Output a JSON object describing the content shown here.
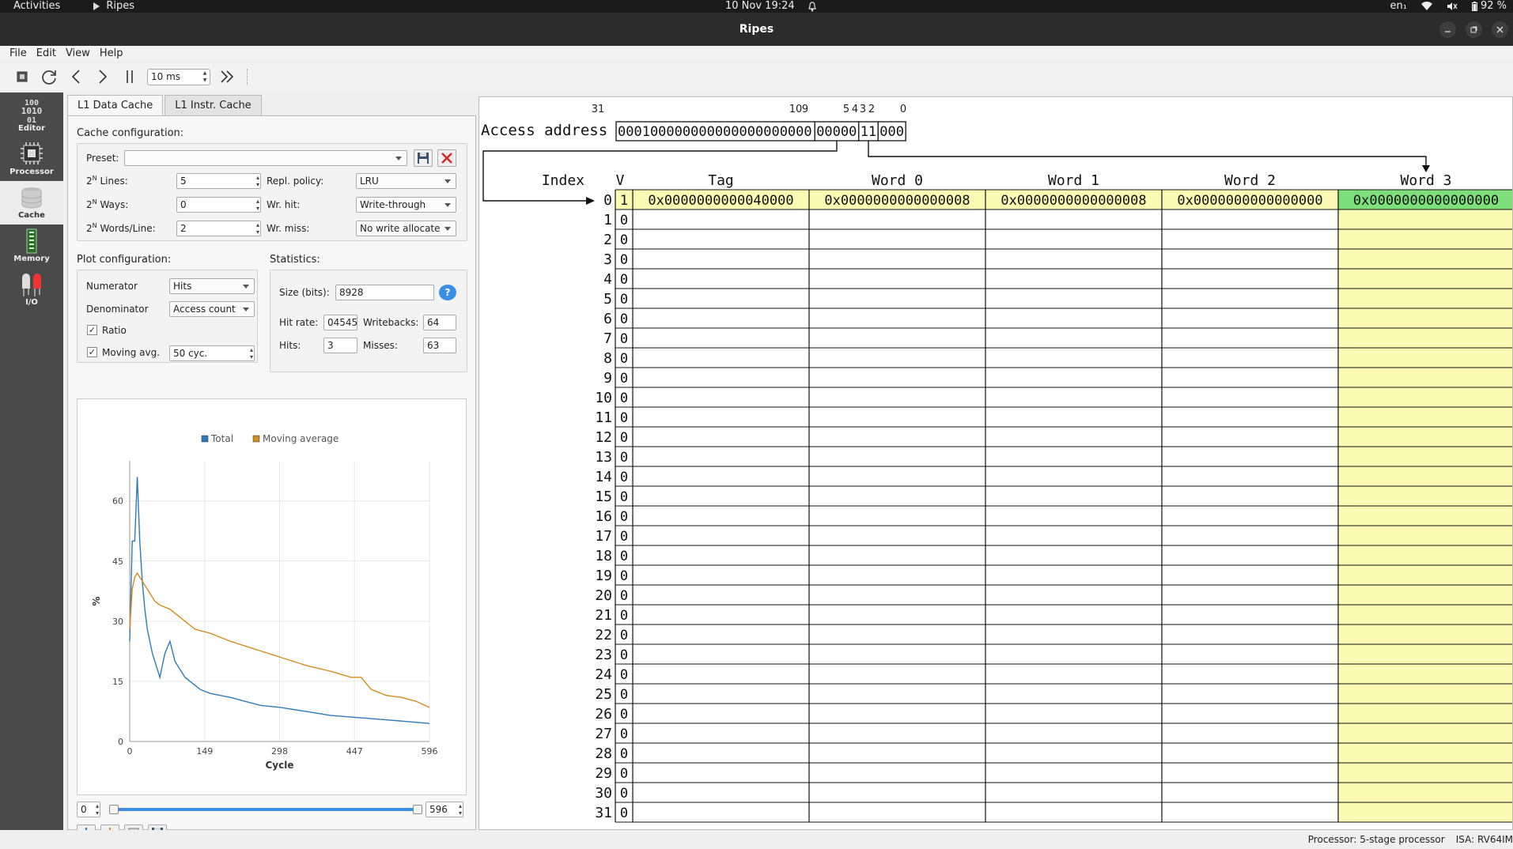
{
  "topbar": {
    "activities": "Activities",
    "app": "Ripes",
    "datetime": "10 Nov  19:24",
    "lang": "en₁",
    "battery": "92 %"
  },
  "window": {
    "title": "Ripes"
  },
  "menu": [
    "File",
    "Edit",
    "View",
    "Help"
  ],
  "toolbar": {
    "delay": "10 ms"
  },
  "sidebar": [
    {
      "label": "Editor",
      "icon": "binary-icon"
    },
    {
      "label": "Processor",
      "icon": "chip-icon"
    },
    {
      "label": "Cache",
      "icon": "database-icon"
    },
    {
      "label": "Memory",
      "icon": "memory-icon"
    },
    {
      "label": "I/O",
      "icon": "leds-icon"
    }
  ],
  "tabs": [
    "L1 Data Cache",
    "L1 Instr. Cache"
  ],
  "cache_config": {
    "title": "Cache configuration:",
    "preset_label": "Preset:",
    "preset_value": "",
    "lines_label": "Lines:",
    "lines_value": "5",
    "ways_label": "Ways:",
    "ways_value": "0",
    "words_label": "Words/Line:",
    "words_value": "2",
    "pow_base": "2",
    "pow_exp": "N",
    "repl_label": "Repl. policy:",
    "repl_value": "LRU",
    "wrhit_label": "Wr. hit:",
    "wrhit_value": "Write-through",
    "wrmiss_label": "Wr. miss:",
    "wrmiss_value": "No write allocate"
  },
  "plot_config": {
    "title": "Plot configuration:",
    "numerator_label": "Numerator",
    "numerator_value": "Hits",
    "denominator_label": "Denominator",
    "denominator_value": "Access count",
    "ratio_label": "Ratio",
    "ratio_checked": "✓",
    "movavg_label": "Moving avg.",
    "movavg_checked": "✓",
    "movavg_value": "50 cyc."
  },
  "statistics": {
    "title": "Statistics:",
    "size_label": "Size (bits):",
    "size_value": "8928",
    "help": "?",
    "hitrate_label": "Hit rate:",
    "hitrate_value": "04545",
    "writebacks_label": "Writebacks:",
    "writebacks_value": "64",
    "hits_label": "Hits:",
    "hits_value": "3",
    "misses_label": "Misses:",
    "misses_value": "63"
  },
  "chart_data": {
    "type": "line",
    "legend": [
      "Total",
      "Moving average"
    ],
    "legend_placement": "top",
    "xlabel": "Cycle",
    "ylabel": "%",
    "xticks": [
      0,
      149,
      298,
      447,
      596
    ],
    "yticks": [
      0,
      15,
      30,
      45,
      60
    ],
    "xlim": [
      0,
      596
    ],
    "ylim": [
      0,
      70
    ],
    "colors": {
      "Total": "#2e7bb8",
      "Moving average": "#d08c1e"
    },
    "series": [
      {
        "name": "Total",
        "x": [
          0,
          5,
          10,
          15,
          20,
          25,
          30,
          35,
          40,
          45,
          50,
          55,
          60,
          70,
          80,
          90,
          100,
          110,
          120,
          140,
          160,
          180,
          200,
          230,
          260,
          300,
          350,
          400,
          450,
          500,
          550,
          596
        ],
        "y": [
          25,
          50,
          50,
          66,
          50,
          40,
          33,
          28,
          25,
          22,
          20,
          18,
          16,
          22,
          25,
          20,
          18,
          16,
          15,
          13,
          12,
          11.5,
          11,
          10,
          9,
          8.5,
          7.5,
          6.5,
          6,
          5.5,
          5,
          4.5
        ]
      },
      {
        "name": "Moving average",
        "x": [
          0,
          5,
          10,
          15,
          20,
          25,
          30,
          40,
          50,
          60,
          80,
          100,
          130,
          160,
          200,
          250,
          300,
          350,
          400,
          440,
          460,
          480,
          510,
          540,
          570,
          596
        ],
        "y": [
          28,
          38,
          41,
          42,
          41,
          40,
          39,
          37,
          35,
          34,
          33,
          31,
          28,
          27,
          25,
          23,
          21,
          19,
          17.5,
          16,
          16,
          13,
          11.5,
          11,
          10,
          8.5
        ]
      }
    ]
  },
  "range": {
    "min": "0",
    "max": "596"
  },
  "address": {
    "label": "Access address",
    "bit_labels": [
      "31",
      "10",
      "9",
      "5",
      "4",
      "3",
      "2",
      "0"
    ],
    "tag_bits": "000100000000000000000000",
    "index_bits": "00000",
    "word_bits": "11",
    "byte_bits": "000"
  },
  "table": {
    "headers": {
      "index": "Index",
      "valid": "V",
      "tag": "Tag",
      "words": [
        "Word 0",
        "Word 1",
        "Word 2",
        "Word 3"
      ]
    },
    "rows": [
      {
        "index": "0",
        "valid": "1",
        "tag": "0x0000000000040000",
        "words": [
          "0x0000000000000008",
          "0x0000000000000008",
          "0x0000000000000000",
          "0x0000000000000000"
        ]
      },
      {
        "index": "1",
        "valid": "0"
      },
      {
        "index": "2",
        "valid": "0"
      },
      {
        "index": "3",
        "valid": "0"
      },
      {
        "index": "4",
        "valid": "0"
      },
      {
        "index": "5",
        "valid": "0"
      },
      {
        "index": "6",
        "valid": "0"
      },
      {
        "index": "7",
        "valid": "0"
      },
      {
        "index": "8",
        "valid": "0"
      },
      {
        "index": "9",
        "valid": "0"
      },
      {
        "index": "10",
        "valid": "0"
      },
      {
        "index": "11",
        "valid": "0"
      },
      {
        "index": "12",
        "valid": "0"
      },
      {
        "index": "13",
        "valid": "0"
      },
      {
        "index": "14",
        "valid": "0"
      },
      {
        "index": "15",
        "valid": "0"
      },
      {
        "index": "16",
        "valid": "0"
      },
      {
        "index": "17",
        "valid": "0"
      },
      {
        "index": "18",
        "valid": "0"
      },
      {
        "index": "19",
        "valid": "0"
      },
      {
        "index": "20",
        "valid": "0"
      },
      {
        "index": "21",
        "valid": "0"
      },
      {
        "index": "22",
        "valid": "0"
      },
      {
        "index": "23",
        "valid": "0"
      },
      {
        "index": "24",
        "valid": "0"
      },
      {
        "index": "25",
        "valid": "0"
      },
      {
        "index": "26",
        "valid": "0"
      },
      {
        "index": "27",
        "valid": "0"
      },
      {
        "index": "28",
        "valid": "0"
      },
      {
        "index": "29",
        "valid": "0"
      },
      {
        "index": "30",
        "valid": "0"
      },
      {
        "index": "31",
        "valid": "0"
      }
    ],
    "highlight_color": "#fbfbb4",
    "hit_color": "#7ee07a"
  },
  "statusbar": {
    "processor": "Processor: 5-stage processor",
    "isa": "ISA: RV64IM"
  }
}
